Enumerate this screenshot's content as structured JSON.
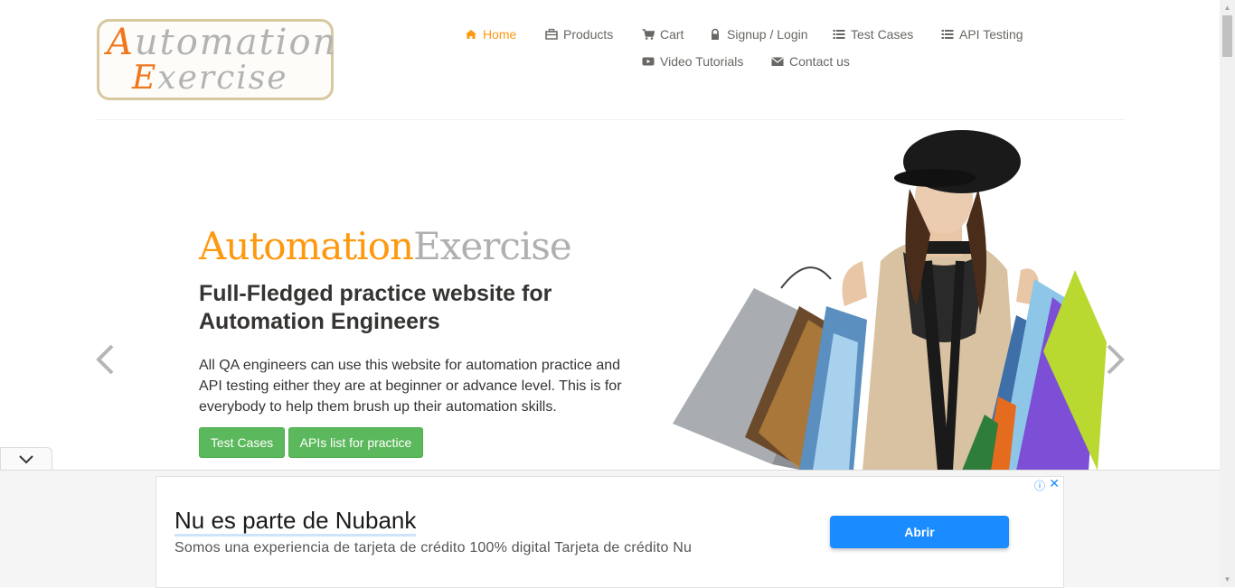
{
  "logo": {
    "line1_cap": "A",
    "line1_rest": "utomation",
    "line2_cap": "E",
    "line2_rest": "xercise"
  },
  "nav": {
    "home": "Home",
    "products": "Products",
    "cart": "Cart",
    "signup": "Signup / Login",
    "test_cases": "Test Cases",
    "api_testing": "API Testing",
    "video": "Video Tutorials",
    "contact": "Contact us"
  },
  "slide": {
    "title_a": "Automation",
    "title_b": "Exercise",
    "heading": "Full-Fledged practice website for Automation Engineers",
    "description": "All QA engineers can use this website for automation practice and API testing either they are at beginner or advance level. This is for everybody to help them brush up their automation skills.",
    "btn_test_cases": "Test Cases",
    "btn_apis": "APIs list for practice"
  },
  "ad": {
    "title": "Nu es parte de Nubank",
    "subtitle": "Somos una experiencia de tarjeta de crédito 100% digital Tarjeta de crédito Nu",
    "button": "Abrir",
    "info_icon": "ⓘ",
    "close_icon": "✕"
  },
  "colors": {
    "accent": "#fe980f",
    "nav_text": "#696763",
    "button_green": "#5cb85c",
    "ad_button": "#1a8cff"
  }
}
